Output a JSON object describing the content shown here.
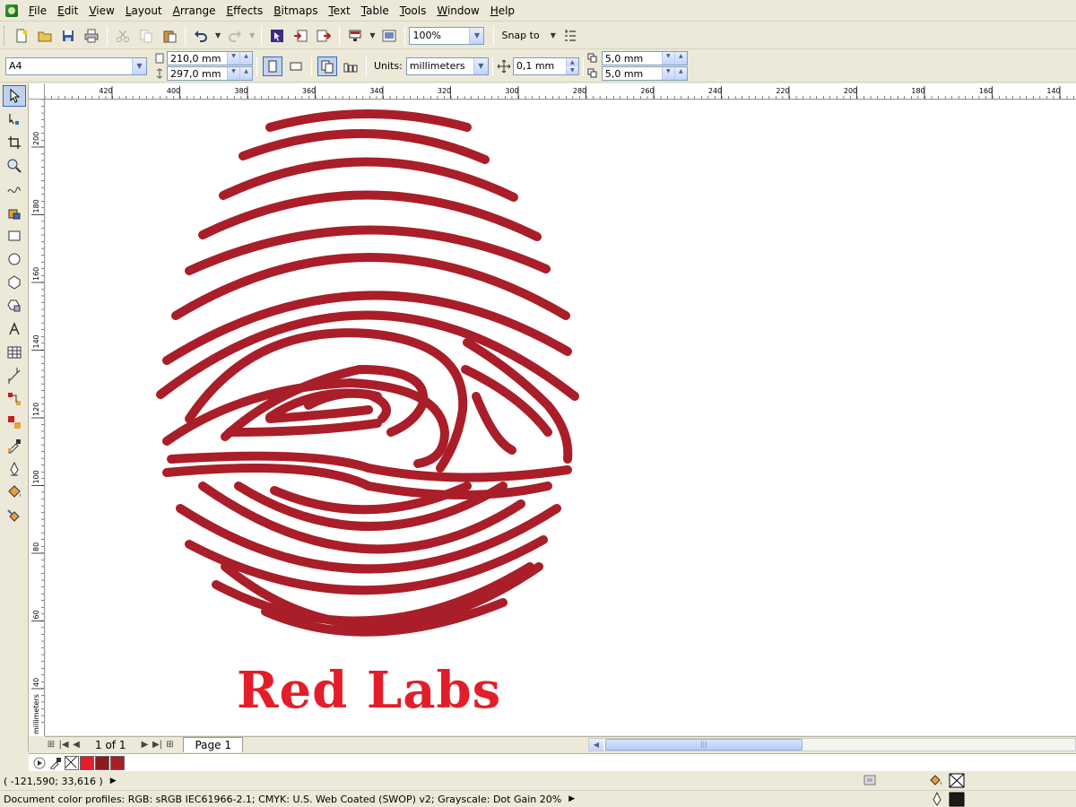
{
  "menu": [
    "File",
    "Edit",
    "View",
    "Layout",
    "Arrange",
    "Effects",
    "Bitmaps",
    "Text",
    "Table",
    "Tools",
    "Window",
    "Help"
  ],
  "toolbar": {
    "zoom": "100%",
    "snap_label": "Snap to"
  },
  "properties": {
    "page_size": "A4",
    "width": "210,0 mm",
    "height": "297,0 mm",
    "units_label": "Units:",
    "units": "millimeters",
    "nudge": "0,1 mm",
    "dup_x": "5,0 mm",
    "dup_y": "5,0 mm"
  },
  "ruler": {
    "h_ticks": [
      "420",
      "400",
      "380",
      "360",
      "340",
      "320",
      "300",
      "280",
      "260",
      "240",
      "220",
      "200",
      "180",
      "160",
      "140"
    ],
    "v_ticks": [
      "200",
      "180",
      "160",
      "140",
      "120",
      "100",
      "80",
      "60",
      "40"
    ],
    "v_unit": "millimeters"
  },
  "canvas": {
    "logo_text": "Red Labs",
    "logo_color": "#E31E2A",
    "fingerprint_color": "#A91E28"
  },
  "pagebar": {
    "page_count": "1 of 1",
    "page_tab": "Page 1"
  },
  "palette": [
    "#E31E2A",
    "#8E1A1F",
    "#A91E28"
  ],
  "status": {
    "coords": "( -121,590; 33,616 )",
    "profiles": "Document color profiles: RGB: sRGB IEC61966-2.1; CMYK: U.S. Web Coated (SWOP) v2; Grayscale: Dot Gain 20%"
  }
}
